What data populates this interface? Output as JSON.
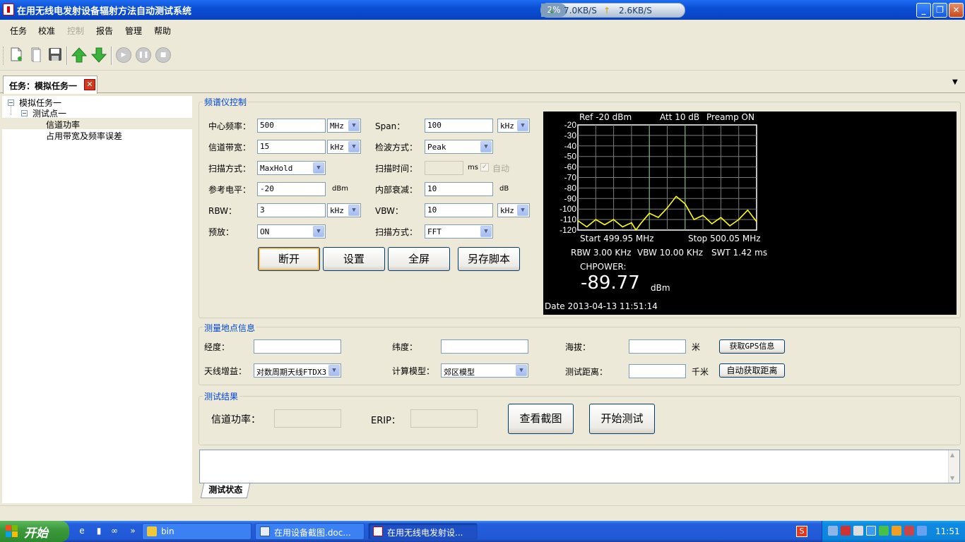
{
  "window": {
    "title": "在用无线电发射设备辐射方法自动测试系统"
  },
  "network": {
    "down": "7.0KB/S",
    "up": "2.6KB/S",
    "cpu": "2%"
  },
  "menu": [
    "任务",
    "校准",
    "控制",
    "报告",
    "管理",
    "帮助"
  ],
  "menu_disabled": "控制",
  "doc_tab": {
    "label": "任务：模拟任务一"
  },
  "tree": {
    "root": "模拟任务一",
    "point": "测试点一",
    "items": [
      "信道功率",
      "占用带宽及频率误差"
    ]
  },
  "spectrum_ctrl": {
    "title": "频谱仪控制",
    "center_freq": {
      "label": "中心频率：",
      "value": "500",
      "unit": "MHz"
    },
    "span": {
      "label": "Span：",
      "value": "100",
      "unit": "kHz"
    },
    "channel_bw": {
      "label": "信道带宽：",
      "value": "15",
      "unit": "kHz"
    },
    "detector": {
      "label": "检波方式：",
      "value": "Peak"
    },
    "sweep_mode": {
      "label": "扫描方式：",
      "value": "MaxHold"
    },
    "sweep_time": {
      "label": "扫描时间：",
      "value": "",
      "unit": "ms",
      "auto_label": "自动"
    },
    "ref_level": {
      "label": "参考电平：",
      "value": "-20",
      "unit": "dBm"
    },
    "atten": {
      "label": "内部衰减：",
      "value": "10",
      "unit": "dB"
    },
    "rbw": {
      "label": "RBW：",
      "value": "3",
      "unit": "kHz"
    },
    "vbw": {
      "label": "VBW：",
      "value": "10",
      "unit": "kHz"
    },
    "preamp": {
      "label": "预放：",
      "value": "ON"
    },
    "scan_mode2": {
      "label": "扫描方式：",
      "value": "FFT"
    },
    "buttons": {
      "disconnect": "断开",
      "settings": "设置",
      "fullscreen": "全屏",
      "save_script": "另存脚本"
    }
  },
  "spectrum_display": {
    "ref": "Ref -20 dBm",
    "att": "Att 10 dB",
    "preamp": "Preamp  ON",
    "start": "Start 499.95 MHz",
    "stop": "Stop 500.05 MHz",
    "rbw": "RBW 3.00 KHz",
    "vbw": "VBW 10.00 KHz",
    "swt": "SWT 1.42 ms",
    "chpower_label": "CHPOWER:",
    "chpower_value": "-89.77",
    "chpower_unit": "dBm",
    "date": "Date 2013-04-13 11:51:14",
    "y_ticks": [
      "-20",
      "-30",
      "-40",
      "-50",
      "-60",
      "-70",
      "-80",
      "-90",
      "-100",
      "-110",
      "-120"
    ]
  },
  "chart_data": {
    "type": "line",
    "title": "",
    "xlabel": "",
    "ylabel": "",
    "xlim": [
      499.95,
      500.05
    ],
    "ylim": [
      -120,
      -20
    ],
    "y_ticks": [
      -20,
      -30,
      -40,
      -50,
      -60,
      -70,
      -80,
      -90,
      -100,
      -110,
      -120
    ],
    "trace_color": "#ffff00",
    "x": [
      499.95,
      499.955,
      499.96,
      499.965,
      499.97,
      499.975,
      499.98,
      499.9825,
      499.985,
      499.99,
      499.995,
      500.0,
      500.005,
      500.01,
      500.015,
      500.02,
      500.025,
      500.03,
      500.035,
      500.04,
      500.045,
      500.05
    ],
    "values": [
      -111,
      -117,
      -110,
      -115,
      -110,
      -117,
      -113,
      -120,
      -114,
      -104,
      -108,
      -99,
      -88,
      -95,
      -110,
      -106,
      -114,
      -108,
      -116,
      -110,
      -101,
      -112
    ]
  },
  "location": {
    "title": "测量地点信息",
    "longitude": {
      "label": "经度：",
      "value": ""
    },
    "latitude": {
      "label": "纬度：",
      "value": ""
    },
    "altitude": {
      "label": "海拔：",
      "value": "",
      "unit": "米"
    },
    "gps_button": "获取GPS信息",
    "antenna_gain": {
      "label": "天线增益：",
      "value": "对数周期天线FTDX3"
    },
    "calc_model": {
      "label": "计算模型：",
      "value": "郊区模型"
    },
    "distance": {
      "label": "测试距离：",
      "value": "",
      "unit": "千米"
    },
    "auto_dist_button": "自动获取距离"
  },
  "results": {
    "title": "测试结果",
    "channel_power": {
      "label": "信道功率：",
      "value": ""
    },
    "erip": {
      "label": "ERIP：",
      "value": ""
    },
    "view_button": "查看截图",
    "start_button": "开始测试"
  },
  "status_tab": "测试状态",
  "taskbar": {
    "start": "开始",
    "tasks": [
      "bin",
      "在用设备截图.doc...",
      "在用无线电发射设..."
    ],
    "clock": "11:51"
  }
}
